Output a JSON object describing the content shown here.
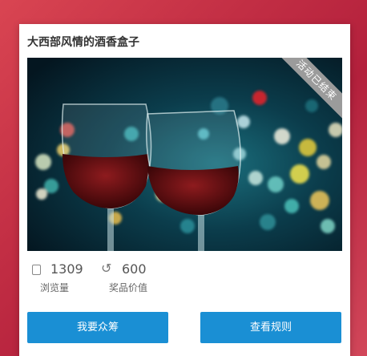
{
  "card": {
    "title": "大西部风情的酒香盒子",
    "ribbon": "活动已结束",
    "image_alt": "two glasses of red wine with colorful bokeh lights"
  },
  "stats": {
    "views": {
      "icon": "document-icon",
      "value": "1309",
      "label": "浏览量"
    },
    "prize": {
      "icon": "reply-arrow-icon",
      "value": "600",
      "label": "奖品价值"
    }
  },
  "buttons": {
    "crowdfund": "我要众筹",
    "rules": "查看规则"
  },
  "colors": {
    "background": "#c22e44",
    "button": "#1a8fd4",
    "ribbon": "#9b9b9b"
  }
}
